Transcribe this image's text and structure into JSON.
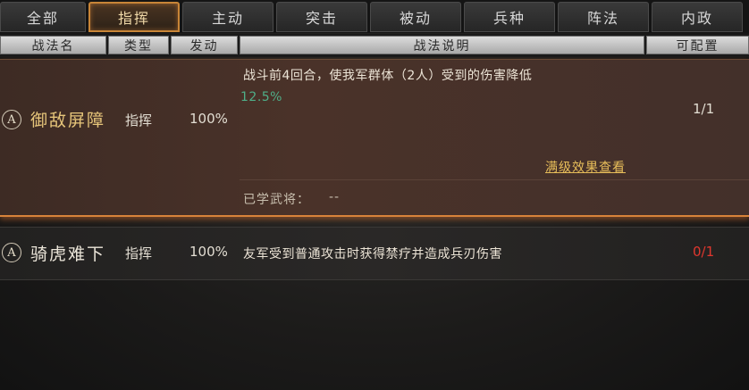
{
  "tabs": [
    {
      "label": "全部"
    },
    {
      "label": "指挥"
    },
    {
      "label": "主动"
    },
    {
      "label": "突击"
    },
    {
      "label": "被动"
    },
    {
      "label": "兵种"
    },
    {
      "label": "阵法"
    },
    {
      "label": "内政"
    }
  ],
  "active_tab": "指挥",
  "headers": {
    "name": "战法名",
    "type": "类型",
    "trigger": "发动",
    "desc": "战法说明",
    "config": "可配置"
  },
  "skills": [
    {
      "grade": "A",
      "name": "御敌屏障",
      "type": "指挥",
      "rate": "100%",
      "desc": "战斗前4回合，使我军群体（2人）受到的伤害降低",
      "desc_value": "12.5%",
      "detail_link": "满级效果查看",
      "learned_label": "已学武将：",
      "learned_value": "--",
      "config": "1/1",
      "name_color": "#e6c57a",
      "config_color": "#e8e2d4"
    },
    {
      "grade": "A",
      "name": "骑虎难下",
      "type": "指挥",
      "rate": "100%",
      "desc": "友军受到普通攻击时获得禁疗并造成兵刃伤害",
      "config": "0/1",
      "name_color": "#ece6da",
      "config_color": "#e0372e"
    }
  ]
}
